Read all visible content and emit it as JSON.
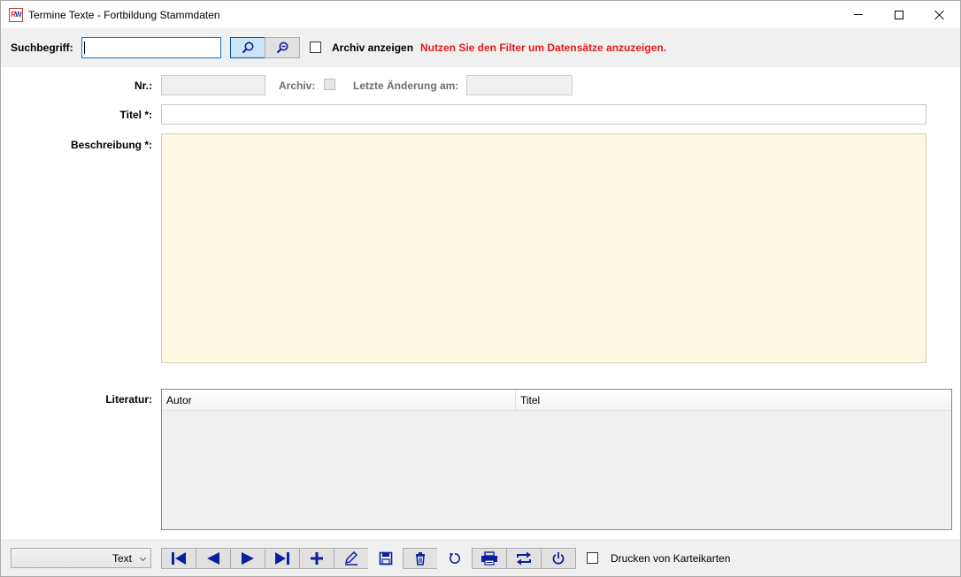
{
  "window": {
    "title": "Termine Texte - Fortbildung Stammdaten",
    "app_icon_text": "RW"
  },
  "search": {
    "label": "Suchbegriff:",
    "value": "",
    "search_button_icon": "magnifier-icon",
    "zoom_out_button_icon": "zoom-out-icon",
    "archive_checkbox_label": "Archiv anzeigen",
    "archive_checked": false,
    "hint": "Nutzen Sie den Filter um Datensätze anzuzeigen.",
    "hint_color": "#e21b1b"
  },
  "form": {
    "nr_label": "Nr.:",
    "nr_value": "",
    "archiv_label": "Archiv:",
    "archiv_checked": false,
    "last_change_label": "Letzte Änderung am:",
    "last_change_value": "",
    "titel_label": "Titel *:",
    "titel_value": "",
    "beschreibung_label": "Beschreibung *:",
    "beschreibung_value": "",
    "beschreibung_bg": "#fff8e3"
  },
  "literatur": {
    "label": "Literatur:",
    "columns": [
      "Autor",
      "Titel"
    ],
    "rows": []
  },
  "bottom": {
    "combo_value": "Text",
    "nav_buttons": [
      "first",
      "previous",
      "next",
      "last",
      "add",
      "edit",
      "save",
      "delete",
      "refresh",
      "print",
      "swap",
      "power"
    ],
    "print_cards_label": "Drucken von Karteikarten",
    "print_cards_checked": false,
    "icon_color": "#0a1f9c"
  }
}
